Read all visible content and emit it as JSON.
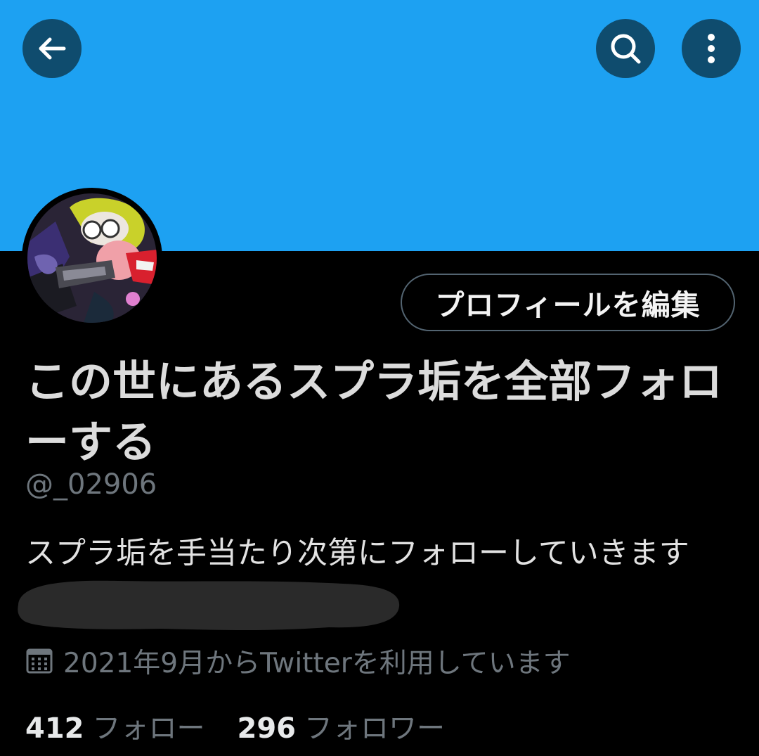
{
  "header": {
    "back_icon": "arrow-left-icon",
    "search_icon": "search-icon",
    "more_icon": "more-vertical-icon",
    "banner_color": "#1da1f2"
  },
  "profile": {
    "edit_button_label": "プロフィールを編集",
    "display_name": "この世にあるスプラ垢を全部フォローする",
    "handle": "@_02906",
    "bio": "スプラ垢を手当たり次第にフォローしていきます",
    "joined_icon": "calendar-icon",
    "joined_text": "2021年9月からTwitterを利用しています"
  },
  "stats": {
    "following_count": "412",
    "following_label": "フォロー",
    "followers_count": "296",
    "followers_label": "フォロワー"
  }
}
